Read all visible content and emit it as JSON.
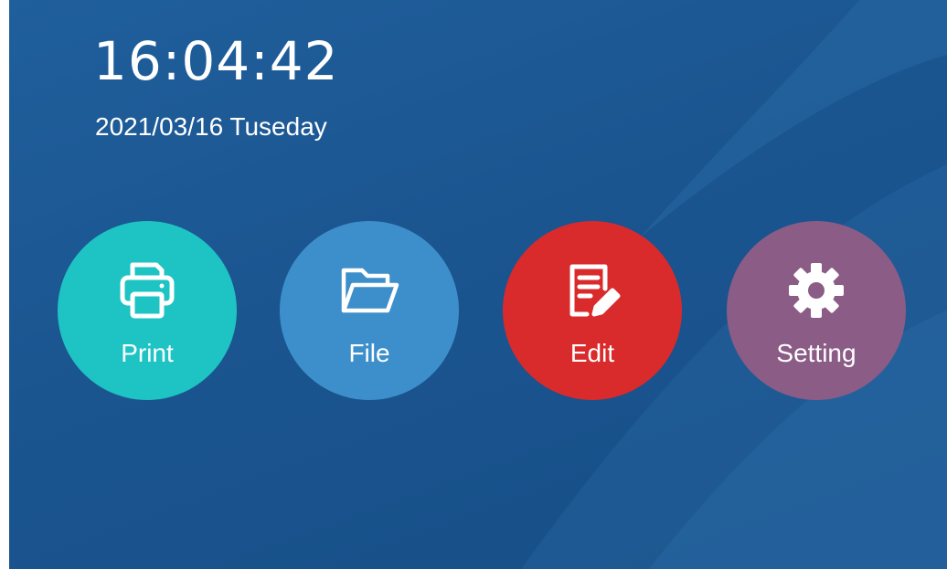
{
  "status": {
    "time": "16:04:42",
    "date": "2021/03/16 Tuseday"
  },
  "apps": [
    {
      "label": "Print",
      "icon": "printer-icon",
      "color": "#1ec3c3"
    },
    {
      "label": "File",
      "icon": "folder-icon",
      "color": "#3d8fcb"
    },
    {
      "label": "Edit",
      "icon": "edit-document-icon",
      "color": "#d92b2b"
    },
    {
      "label": "Setting",
      "icon": "gear-icon",
      "color": "#8a5c86"
    }
  ],
  "colors": {
    "background": "#1b5590",
    "text": "#ffffff"
  }
}
